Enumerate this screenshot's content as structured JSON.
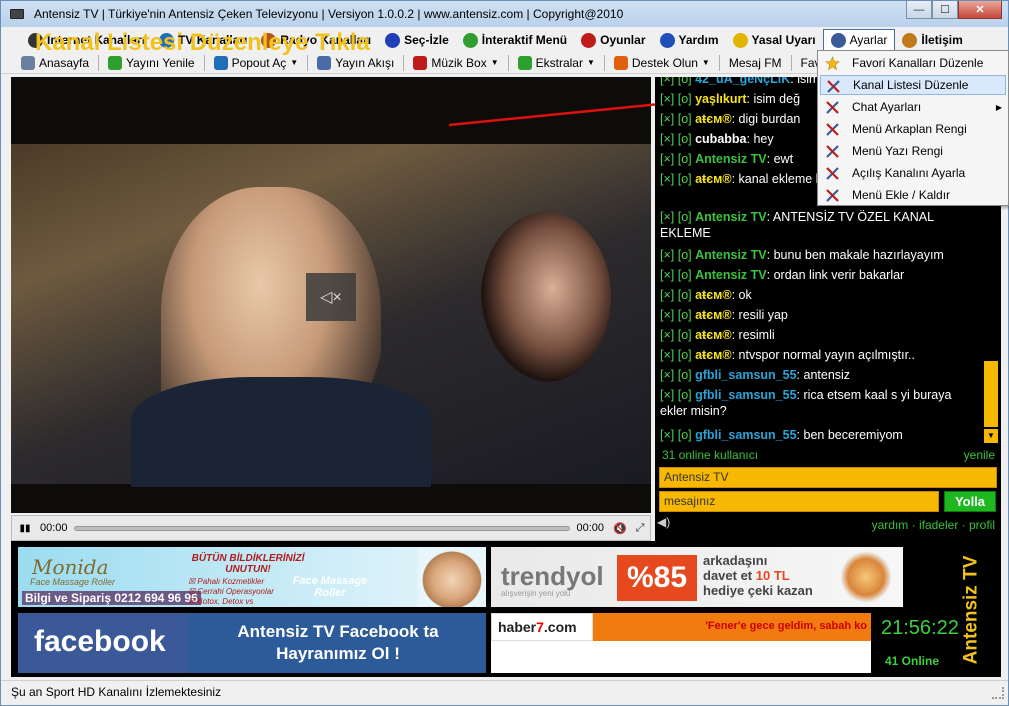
{
  "window": {
    "title": "Antensiz TV | Türkiye'nin Antensiz Çeken Televizyonu | Versiyon 1.0.0.2 | www.antensiz.com | Copyright@2010",
    "buttons": {
      "minimize": "—",
      "maximize": "☐",
      "close": "✕"
    }
  },
  "menubar": {
    "items": [
      {
        "label": "İnternet Kanalları",
        "icon": "soccer-ball-icon",
        "color": "#333333"
      },
      {
        "label": "TV Kanalları",
        "icon": "tv-circle-icon",
        "color": "#1f6fb8"
      },
      {
        "label": "Radyo Kanalları",
        "icon": "radio-icon",
        "color": "#b3541e"
      },
      {
        "label": "Seç-İzle",
        "icon": "dvd-icon",
        "color": "#1f3fb8"
      },
      {
        "label": "İnteraktif Menü",
        "icon": "interactive-icon",
        "color": "#2f9e2f"
      },
      {
        "label": "Oyunlar",
        "icon": "game-icon",
        "color": "#c01b1b"
      },
      {
        "label": "Yardım",
        "icon": "help-icon",
        "color": "#1f4fb8"
      },
      {
        "label": "Yasal Uyarı",
        "icon": "warning-icon",
        "color": "#e0b400"
      },
      {
        "label": "Ayarlar",
        "icon": "tools-icon",
        "color": "#3a5a9a"
      },
      {
        "label": "İletişim",
        "icon": "contact-icon",
        "color": "#c07a1b"
      }
    ]
  },
  "toolbar": {
    "items": [
      {
        "label": "Anasayfa",
        "icon": "home-icon",
        "color": "#6b7fa0",
        "caret": false
      },
      {
        "label": "Yayını Yenile",
        "icon": "refresh-icon",
        "color": "#2fa02f",
        "caret": false
      },
      {
        "label": "Popout Aç",
        "icon": "popout-icon",
        "color": "#1f6fb8",
        "caret": true
      },
      {
        "label": "Yayın Akışı",
        "icon": "tv-schedule-icon",
        "color": "#4a6aa8",
        "caret": false
      },
      {
        "label": "Müzik Box",
        "icon": "music-icon",
        "color": "#c01b1b",
        "caret": true
      },
      {
        "label": "Ekstralar",
        "icon": "plus-icon",
        "color": "#2fa02f",
        "caret": true
      },
      {
        "label": "Destek Olun",
        "icon": "support-icon",
        "color": "#e06010",
        "caret": true
      },
      {
        "label": "Mesaj FM",
        "icon": "",
        "color": "",
        "caret": false
      },
      {
        "label": "Favori Kana",
        "icon": "",
        "color": "",
        "caret": true
      }
    ]
  },
  "video": {
    "caption": "Kanal Listesi Düzenleye Tıkla",
    "current_time": "00:00",
    "total_time": "00:00",
    "play_icon": "▮▮",
    "mute_icon": "🔇",
    "fullscreen_icon": "⤢"
  },
  "chat": {
    "messages": [
      {
        "user": "42_uA_geNçLiK",
        "text": " isim değ...",
        "color": "b"
      },
      {
        "user": "yaşlıkurt",
        "text": " isim değ",
        "color": "y"
      },
      {
        "user": "aŧєм®",
        "text": " digi burdan",
        "color": "y"
      },
      {
        "user": "cubabba",
        "text": " hey",
        "color": "w"
      },
      {
        "user": "Antensiz TV",
        "text": " ewt",
        "color": "g"
      },
      {
        "user": "aŧєм®",
        "text": " kanal ekleme benim..",
        "color": "y"
      },
      {
        "user": "Antensiz TV",
        "text": " ANTENSİZ TV ÖZEL KANAL EKLEME",
        "color": "g"
      },
      {
        "user": "Antensiz TV",
        "text": " bunu ben makale hazırlayayım",
        "color": "g"
      },
      {
        "user": "Antensiz TV",
        "text": " ordan link verir bakarlar",
        "color": "g"
      },
      {
        "user": "aŧєм®",
        "text": " ok",
        "color": "y"
      },
      {
        "user": "aŧєм®",
        "text": " resili yap",
        "color": "y"
      },
      {
        "user": "aŧєм®",
        "text": " resimli",
        "color": "y"
      },
      {
        "user": "aŧєм®",
        "text": " ntvspor normal yayın açılmıştır..",
        "color": "y"
      },
      {
        "user": "gfbli_samsun_55",
        "text": " antensiz",
        "color": "b"
      },
      {
        "user": "gfbli_samsun_55",
        "text": " rica etsem kaal s yi buraya ekler misin?",
        "color": "b"
      },
      {
        "user": "gfbli_samsun_55",
        "text": " ben beceremiyom",
        "color": "b"
      }
    ],
    "prefix": "[×] [o] ",
    "online_count": "31 online kullanıcı",
    "refresh": "yenile",
    "name_value": "Antensiz TV",
    "message_placeholder": "mesajınız",
    "send_label": "Yolla",
    "links": [
      "yardım",
      "ifadeler",
      "profil"
    ],
    "link_sep": " · "
  },
  "ads": {
    "monida": {
      "brand": "Monida",
      "sub": "Face Massage Roller",
      "phone": "Bilgi ve Sipariş 0212 694 96 96",
      "headline": "BÜTÜN BİLDİKLERİNİZİ UNUTUN!",
      "list": [
        "Pahalı Kozmetikler",
        "Cerrahi Operasyonlar",
        "Botox, Detox vs"
      ],
      "product": "Face Massage Roller"
    },
    "trendyol": {
      "brand": "trendyol",
      "tagline": "alışverişin yeni yolu",
      "percent": "%85",
      "line1": "arkadaşını",
      "line2a": "davet et ",
      "line2b": "10 TL",
      "line3": "hediye çeki kazan"
    },
    "facebook": {
      "logo": "facebook",
      "text": "Antensiz TV Facebook ta Hayranımız Ol !"
    },
    "news": {
      "logo_a": "haber",
      "logo_b": "7",
      "logo_c": ".com",
      "ticker": "'Fener'e gece geldim, sabah ko"
    }
  },
  "clock": "21:56:22",
  "online_label": "41 Online",
  "brand_vertical": "Antensiz TV",
  "status": "Şu an Sport HD Kanalını İzlemektesiniz",
  "dropdown": {
    "items": [
      {
        "label": "Favori Kanalları Düzenle",
        "icon": "star-icon",
        "highlight": false,
        "submenu": false
      },
      {
        "label": "Kanal Listesi Düzenle",
        "icon": "tools-icon",
        "highlight": true,
        "submenu": false
      },
      {
        "label": "Chat Ayarları",
        "icon": "tools-icon",
        "highlight": false,
        "submenu": true
      },
      {
        "label": "Menü Arkaplan Rengi",
        "icon": "tools-icon",
        "highlight": false,
        "submenu": false
      },
      {
        "label": "Menü Yazı Rengi",
        "icon": "tools-icon",
        "highlight": false,
        "submenu": false
      },
      {
        "label": "Açılış Kanalını Ayarla",
        "icon": "tools-icon",
        "highlight": false,
        "submenu": false
      },
      {
        "label": "Menü Ekle / Kaldır",
        "icon": "tools-icon",
        "highlight": false,
        "submenu": false
      }
    ]
  }
}
